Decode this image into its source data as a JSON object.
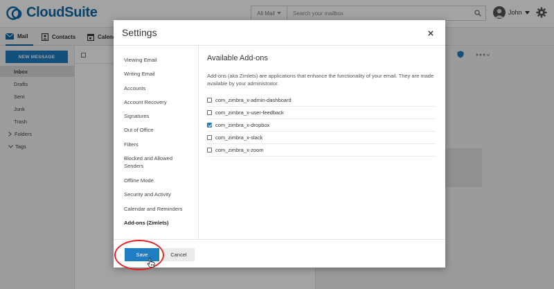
{
  "app": {
    "logo_text": "CloudSuite",
    "brand_color": "#0b6aa8",
    "accent_color": "#1f7ec2"
  },
  "search": {
    "scope": "All Mail",
    "placeholder": "Search your mailbox"
  },
  "user": {
    "name": "John"
  },
  "nav": {
    "tabs": [
      {
        "label": "Mail",
        "icon": "envelope-icon",
        "active": true
      },
      {
        "label": "Contacts",
        "icon": "contacts-icon",
        "active": false
      },
      {
        "label": "Calendar",
        "icon": "calendar-icon",
        "active": false
      }
    ]
  },
  "sidebar": {
    "new_message_label": "NEW MESSAGE",
    "folders": [
      "Inbox",
      "Drafts",
      "Sent",
      "Junk",
      "Trash"
    ],
    "groups": [
      "Folders",
      "Tags"
    ]
  },
  "dialog": {
    "title": "Settings",
    "close_icon": "close-icon",
    "nav_items": [
      {
        "label": "Viewing Email",
        "active": false
      },
      {
        "label": "Writing Email",
        "active": false
      },
      {
        "label": "Accounts",
        "active": false
      },
      {
        "label": "Account Recovery",
        "active": false
      },
      {
        "label": "Signatures",
        "active": false
      },
      {
        "label": "Out of Office",
        "active": false
      },
      {
        "label": "Filters",
        "active": false
      },
      {
        "label": "Blocked and Allowed Senders",
        "active": false
      },
      {
        "label": "Offline Mode",
        "active": false
      },
      {
        "label": "Security and Activity",
        "active": false
      },
      {
        "label": "Calendar and Reminders",
        "active": false
      },
      {
        "label": "Add-ons (Zimlets)",
        "active": true
      }
    ],
    "content": {
      "title": "Available Add-ons",
      "description": "Add-ons (aka Zimlets) are applications that enhance the functionality of your email. They are made available by your administrator.",
      "addons": [
        {
          "name": "com_zimbra_x-admin-dashboard",
          "checked": false
        },
        {
          "name": "com_zimbra_x-user-feedback",
          "checked": false
        },
        {
          "name": "com_zimbra_x-dropbox",
          "checked": true
        },
        {
          "name": "com_zimbra_x-slack",
          "checked": false
        },
        {
          "name": "com_zimbra_x-zoom",
          "checked": false
        }
      ]
    },
    "footer": {
      "save_label": "Save",
      "cancel_label": "Cancel"
    }
  },
  "annotation": {
    "highlight_color": "#e3262a"
  }
}
